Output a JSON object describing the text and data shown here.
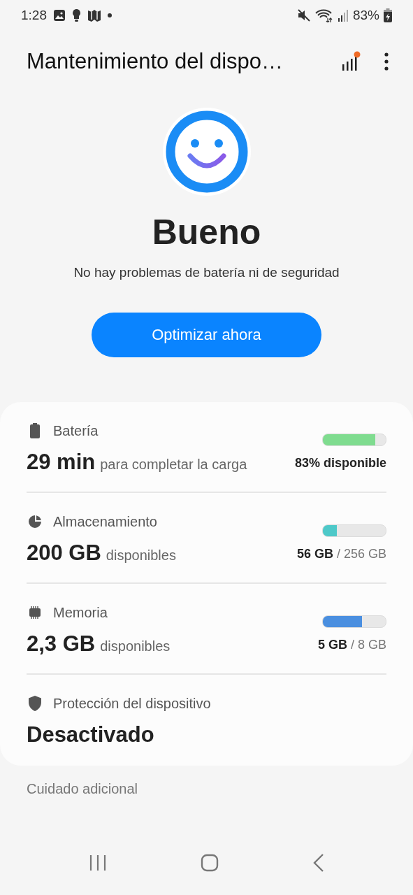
{
  "status_bar": {
    "time": "1:28",
    "battery": "83%"
  },
  "app_bar": {
    "title": "Mantenimiento del dispo…",
    "notification_dot": true
  },
  "status": {
    "title": "Bueno",
    "message": "No hay problemas de batería ni de seguridad",
    "button": "Optimizar ahora"
  },
  "items": [
    {
      "kind": "battery",
      "label": "Batería",
      "value": "29 min",
      "suffix": "para completar la carga",
      "level": 0.83,
      "color": "#7fdc8f",
      "reading_strong": "83% disponible"
    },
    {
      "kind": "storage",
      "label": "Almacenamiento",
      "value": "200 GB",
      "suffix": "disponibles",
      "level": 0.22,
      "color": "#4ec9c9",
      "reading_strong": "56 GB",
      "reading_rest": " / 256 GB"
    },
    {
      "kind": "memory",
      "label": "Memoria",
      "value": "2,3 GB",
      "suffix": "disponibles",
      "level": 0.62,
      "color": "#4a8fe0",
      "reading_strong": "5 GB",
      "reading_rest": " / 8 GB"
    },
    {
      "kind": "protection",
      "label": "Protección del dispositivo",
      "value": "Desactivado"
    }
  ],
  "section_header": "Cuidado adicional"
}
